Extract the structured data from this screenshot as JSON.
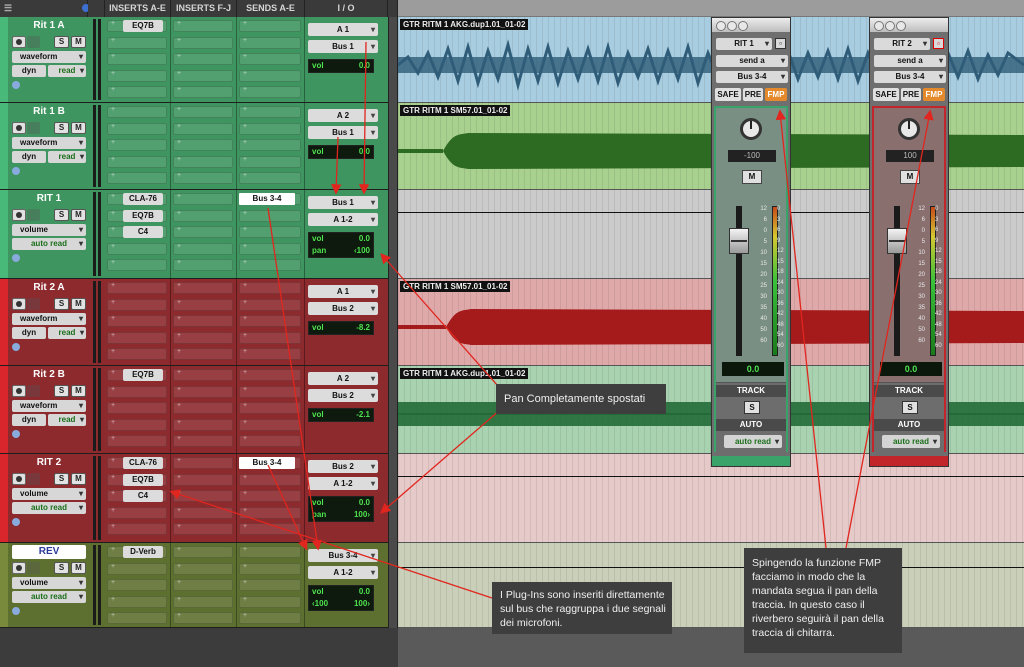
{
  "header": {
    "inserts_ae": "INSERTS A-E",
    "inserts_fj": "INSERTS F-J",
    "sends_ae": "SENDS A-E",
    "io": "I / O"
  },
  "tracks": [
    {
      "name": "Rit 1 A",
      "color": "green",
      "view": "waveform",
      "auto_a": "dyn",
      "auto_b": "read",
      "inserts": [
        "EQ7B"
      ],
      "sends": [],
      "io": [
        "A 1",
        "Bus 1"
      ],
      "lcd": [
        [
          "vol",
          "0.0"
        ]
      ]
    },
    {
      "name": "Rit 1 B",
      "color": "green",
      "view": "waveform",
      "auto_a": "dyn",
      "auto_b": "read",
      "inserts": [],
      "sends": [],
      "io": [
        "A 2",
        "Bus 1"
      ],
      "lcd": [
        [
          "vol",
          "0.0"
        ]
      ]
    },
    {
      "name": "RIT 1",
      "color": "green",
      "view": "volume",
      "auto": "auto read",
      "inserts": [
        "CLA-76",
        "EQ7B",
        "C4"
      ],
      "sends": [
        "Bus 3-4"
      ],
      "io": [
        "Bus 1",
        "A 1-2"
      ],
      "lcd": [
        [
          "vol",
          "0.0"
        ],
        [
          "pan",
          "‹100"
        ]
      ]
    },
    {
      "name": "Rit 2 A",
      "color": "red",
      "view": "waveform",
      "auto_a": "dyn",
      "auto_b": "read",
      "inserts": [],
      "sends": [],
      "io": [
        "A 1",
        "Bus 2"
      ],
      "lcd": [
        [
          "vol",
          "-8.2"
        ]
      ]
    },
    {
      "name": "Rit 2 B",
      "color": "red",
      "view": "waveform",
      "auto_a": "dyn",
      "auto_b": "read",
      "inserts": [
        "EQ7B"
      ],
      "sends": [],
      "io": [
        "A 2",
        "Bus 2"
      ],
      "lcd": [
        [
          "vol",
          "-2.1"
        ]
      ]
    },
    {
      "name": "RIT 2",
      "color": "red",
      "view": "volume",
      "auto": "auto read",
      "inserts": [
        "CLA-76",
        "EQ7B",
        "C4"
      ],
      "sends": [
        "Bus 3-4"
      ],
      "io": [
        "Bus 2",
        "A 1-2"
      ],
      "lcd": [
        [
          "vol",
          "0.0"
        ],
        [
          "pan",
          "100›"
        ]
      ]
    },
    {
      "name": "REV",
      "color": "olive",
      "view": "volume",
      "auto": "auto read",
      "inserts": [
        "D-Verb"
      ],
      "sends": [],
      "io": [
        "Bus 3-4",
        "A 1-2"
      ],
      "lcd": [
        [
          "vol",
          "0.0"
        ],
        [
          "‹100",
          "100›"
        ]
      ]
    }
  ],
  "clips": [
    {
      "name": "GTR RITM 1 AKG.dup1.01_01-02",
      "color": "blue"
    },
    {
      "name": "GTR RITM 1 SM57.01_01-02",
      "color": "green"
    },
    {
      "name": "GTR RITM 1 SM57.01_01-02",
      "color": "red"
    },
    {
      "name": "GTR RITM 1 AKG.dup1.01_01-02",
      "color": "green"
    }
  ],
  "strips": [
    {
      "track": "RIT 1",
      "send": "send a",
      "bus": "Bus 3-4",
      "safe": "SAFE",
      "pre": "PRE",
      "fmp": "FMP",
      "pan": "-100",
      "mute": "M",
      "vol": "0.0",
      "track_label": "TRACK",
      "solo": "S",
      "auto_label": "AUTO",
      "auto": "auto read",
      "accent": "#3aa36a"
    },
    {
      "track": "RIT 2",
      "send": "send a",
      "bus": "Bus 3-4",
      "safe": "SAFE",
      "pre": "PRE",
      "fmp": "FMP",
      "pan": "100",
      "mute": "M",
      "vol": "0.0",
      "track_label": "TRACK",
      "solo": "S",
      "auto_label": "AUTO",
      "auto": "auto read",
      "accent": "#c2262b"
    }
  ],
  "scale": [
    "12",
    "6",
    "0",
    "5",
    "10",
    "15",
    "20",
    "25",
    "30",
    "35",
    "40",
    "50",
    "60"
  ],
  "meter_scale": [
    "0",
    "3",
    "6",
    "9",
    "12",
    "15",
    "18",
    "24",
    "30",
    "36",
    "42",
    "48",
    "54",
    "60"
  ],
  "callouts": {
    "pan": "Pan Completamente spostati",
    "plugins": "I Plug-Ins sono inseriti direttamente sul bus che raggruppa i due segnali dei microfoni.",
    "fmp": "Spingendo la funzione FMP facciamo in modo che la mandata segua il pan della traccia. In questo caso il riverbero seguirà il pan della traccia di chitarra."
  },
  "colors": {
    "green": "#3f9560",
    "red": "#8d2a2e",
    "olive": "#5e7030",
    "arrow": "#e0261e",
    "lcd_text": "#4fe24f"
  }
}
